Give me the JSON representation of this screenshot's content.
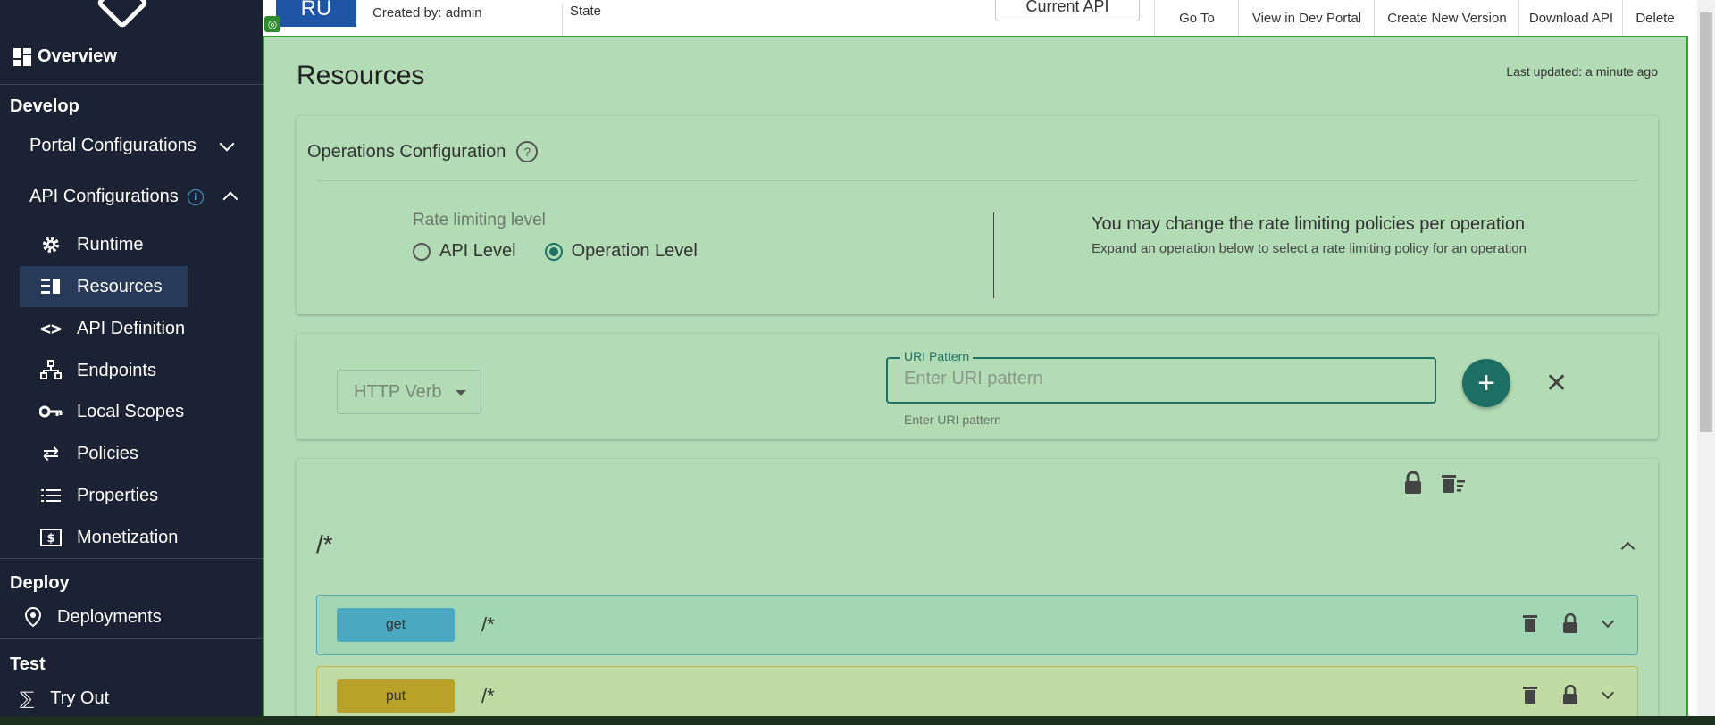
{
  "sidebar": {
    "overview": "Overview",
    "develop": "Develop",
    "portal_configurations": "Portal Configurations",
    "api_configurations": "API Configurations",
    "sub_items": [
      {
        "label": "Runtime",
        "icon": "gear-icon"
      },
      {
        "label": "Resources",
        "icon": "resources-icon"
      },
      {
        "label": "API Definition",
        "icon": "code-icon"
      },
      {
        "label": "Endpoints",
        "icon": "endpoints-icon"
      },
      {
        "label": "Local Scopes",
        "icon": "key-icon"
      },
      {
        "label": "Policies",
        "icon": "swap-icon"
      },
      {
        "label": "Properties",
        "icon": "list-icon"
      },
      {
        "label": "Monetization",
        "icon": "money-icon"
      }
    ],
    "deploy": "Deploy",
    "deployments": "Deployments",
    "test": "Test",
    "try_out": "Try Out"
  },
  "topbar": {
    "avatar": "RU",
    "created_by": "Created by: admin",
    "state": "State",
    "current_api": "Current API",
    "buttons": [
      "Go To",
      "View in Dev Portal",
      "Create New Version",
      "Download API",
      "Delete"
    ]
  },
  "main": {
    "title": "Resources",
    "last_updated": "Last updated: a minute ago",
    "ops_config": {
      "title": "Operations Configuration",
      "rate_limit_label": "Rate limiting level",
      "options": [
        "API Level",
        "Operation Level"
      ],
      "selected": "Operation Level",
      "message": "You may change the rate limiting policies per operation",
      "submessage": "Expand an operation below to select a rate limiting policy for an operation"
    },
    "add_resource": {
      "verb_placeholder": "HTTP Verb",
      "uri_label": "URI Pattern",
      "uri_placeholder": "Enter URI pattern",
      "uri_help": "Enter URI pattern"
    },
    "resource_group": {
      "path": "/*",
      "operations": [
        {
          "verb": "get",
          "path": "/*",
          "color": "#4aa8c0",
          "row_bg": "#a3d6b4",
          "row_border": "#4aa8c0"
        },
        {
          "verb": "put",
          "path": "/*",
          "color": "#b9a22a",
          "row_bg": "#c2dba4",
          "row_border": "#c9b54a"
        }
      ]
    }
  },
  "colors": {
    "accent": "#1e7165",
    "sidebar_bg": "#1a2233",
    "main_bg": "#b3dbb5"
  }
}
